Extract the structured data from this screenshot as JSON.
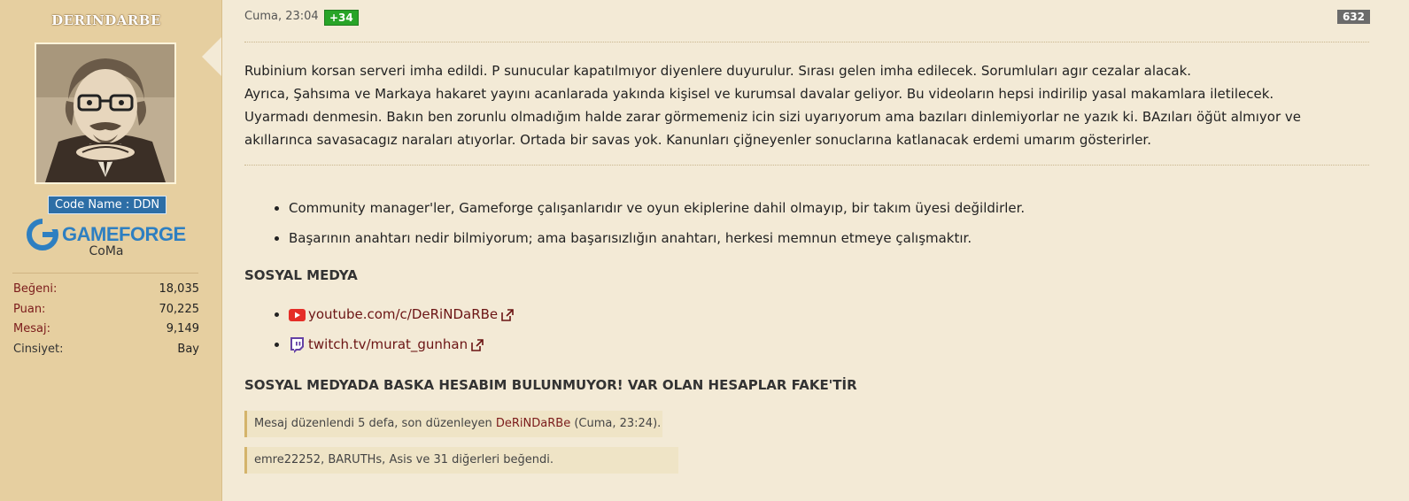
{
  "sidebar": {
    "username": "DERINDARBE",
    "code_name": "Code Name : DDN",
    "brand": "GAMEFORGE",
    "role": "CoMa",
    "stats": [
      {
        "label": "Beğeni:",
        "value": "18,035"
      },
      {
        "label": "Puan:",
        "value": "70,225"
      },
      {
        "label": "Mesaj:",
        "value": "9,149"
      },
      {
        "label": "Cinsiyet:",
        "value": "Bay"
      }
    ]
  },
  "post": {
    "date": "Cuma, 23:04",
    "reaction_score": "+34",
    "post_number": "632",
    "paragraph": [
      "Rubinium korsan serveri imha edildi. P sunucular kapatılmıyor diyenlere duyurulur. Sırası gelen imha edilecek. Sorumluları agır cezalar alacak.",
      "Ayrıca, Şahsıma ve Markaya hakaret yayını acanlarada yakında kişisel ve kurumsal davalar geliyor. Bu videoların hepsi indirilip yasal makamlara iletilecek.",
      "Uyarmadı denmesin. Bakın ben zorunlu olmadığım halde zarar görmemeniz icin sizi uyarıyorum ama bazıları dinlemiyorlar ne yazık ki. BAzıları öğüt almıyor ve",
      "akıllarınca savasacagız naraları atıyorlar. Ortada bir savas yok. Kanunları çiğneyenler sonuclarına katlanacak erdemi umarım gösterirler."
    ]
  },
  "signature": {
    "bullets": [
      "Community manager'ler, Gameforge çalışanlarıdır ve oyun ekiplerine dahil olmayıp, bir takım üyesi değildirler.",
      "Başarının anahtarı nedir bilmiyorum; ama başarısızlığın anahtarı, herkesi memnun etmeye çalışmaktır."
    ],
    "social_heading": "SOSYAL MEDYA",
    "social_links": [
      {
        "icon": "youtube-icon",
        "text": "youtube.com/c/DeRiNDaRBe",
        "color": "#e52d27"
      },
      {
        "icon": "twitch-icon",
        "text": "twitch.tv/murat_gunhan",
        "color": "#6441a5"
      }
    ],
    "warning": "SOSYAL MEDYADA BASKA HESABIM BULUNMUYOR! VAR OLAN HESAPLAR FAKE'TİR"
  },
  "footer": {
    "edit_prefix": "Mesaj düzenlendi 5 defa, son düzenleyen ",
    "edit_user": "DeRiNDaRBe",
    "edit_suffix": " (Cuma, 23:24).",
    "likes_text": "emre22252, BARUTHs, Asis ve 31 diğerleri beğendi."
  },
  "colors": {
    "sidebar_bg": "#e6cfa0",
    "page_bg": "#f3ead6",
    "link": "#6b1414",
    "reaction_green": "#28a428"
  }
}
